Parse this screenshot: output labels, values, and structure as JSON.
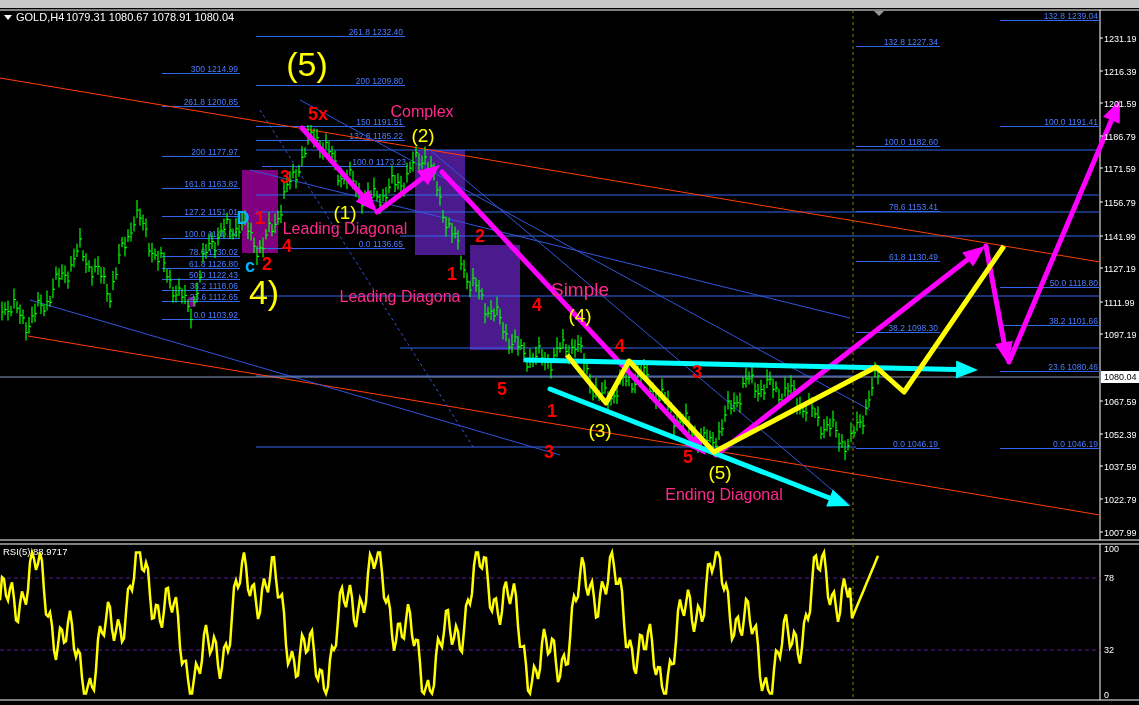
{
  "header": {
    "symbol": "GOLD,H4",
    "quotes": [
      "1079.31",
      "1080.67",
      "1078.91",
      "1080.04"
    ]
  },
  "fib_labels": [
    "300 1214.99",
    "261.8 1200.85",
    "200 1177.97",
    "161.8 1163.82",
    "127.2 1151.01",
    "100.0 1140.94",
    "78.6 1130.02",
    "61.8 1126.80",
    "50.0 1122.43",
    "38.2 1118.06",
    "23.6 1112.65",
    "0.0 1103.92",
    "261.8 1232.40",
    "200 1209.80",
    "150 1191.51",
    "132.8 1185.22",
    "100.0 1173.23",
    "0.0 1136.65",
    "132.8 1227.34",
    "100.0 1182.60",
    "78.6 1153.41",
    "61.8 1130.49",
    "38.2 1098.30",
    "0.0 1046.19",
    "132.8 1239.04",
    "100.0 1191.41",
    "50.0 1118.80",
    "38.2 1101.66",
    "23.6 1080.46",
    "0.0 1046.19"
  ],
  "wave_labels": [
    {
      "text": "(5)",
      "kind": "big",
      "color": "#ffff00"
    },
    {
      "text": "5x",
      "kind": "count",
      "color": "#ff0000"
    },
    {
      "text": "Complex",
      "kind": "annotation",
      "color": "#ff2a8c"
    },
    {
      "text": "(2)",
      "kind": "degree",
      "color": "#ffff00"
    },
    {
      "text": "3",
      "kind": "count",
      "color": "#ff0000"
    },
    {
      "text": "D",
      "kind": "count",
      "color": "#00b7ff"
    },
    {
      "text": "1",
      "kind": "count",
      "color": "#ff0000"
    },
    {
      "text": "4",
      "kind": "count",
      "color": "#ff0000"
    },
    {
      "text": "2",
      "kind": "count",
      "color": "#ff0000"
    },
    {
      "text": "c",
      "kind": "count",
      "color": "#00b7ff"
    },
    {
      "text": "4)",
      "kind": "big",
      "color": "#ffff00"
    },
    {
      "text": "(1)",
      "kind": "degree",
      "color": "#ffff00"
    },
    {
      "text": "Leading Diagonal",
      "kind": "annotation",
      "color": "#ff2a8c"
    },
    {
      "text": "2",
      "kind": "count",
      "color": "#ff0000"
    },
    {
      "text": "1",
      "kind": "count",
      "color": "#ff0000"
    },
    {
      "text": "Leading Diagona",
      "kind": "annotation",
      "color": "#ff2a8c"
    },
    {
      "text": "Simple",
      "kind": "annotation",
      "color": "#ff2a8c"
    },
    {
      "text": "(4)",
      "kind": "degree",
      "color": "#ffff00"
    },
    {
      "text": "4",
      "kind": "count",
      "color": "#ff0000"
    },
    {
      "text": "4",
      "kind": "count",
      "color": "#ff0000"
    },
    {
      "text": "3",
      "kind": "count",
      "color": "#ff0000"
    },
    {
      "text": "5",
      "kind": "count",
      "color": "#ff0000"
    },
    {
      "text": "1",
      "kind": "count",
      "color": "#ff0000"
    },
    {
      "text": "(3)",
      "kind": "degree",
      "color": "#ffff00"
    },
    {
      "text": "3",
      "kind": "count",
      "color": "#ff0000"
    },
    {
      "text": "5",
      "kind": "count",
      "color": "#ff0000"
    },
    {
      "text": "(5)",
      "kind": "degree",
      "color": "#ffff00"
    },
    {
      "text": "Ending Diagonal",
      "kind": "annotation",
      "color": "#ff2a8c"
    }
  ],
  "price_axis": [
    "1231.19",
    "1216.39",
    "1201.59",
    "1186.79",
    "1171.59",
    "1156.79",
    "1141.99",
    "1127.19",
    "1111.99",
    "1097.19",
    "1067.59",
    "1052.39",
    "1037.59",
    "1022.79",
    "1007.99"
  ],
  "current_price": "1080.04",
  "rsi": {
    "title": "RSI(5) 88.9717",
    "axis": [
      "100",
      "78",
      "32",
      "0"
    ]
  }
}
